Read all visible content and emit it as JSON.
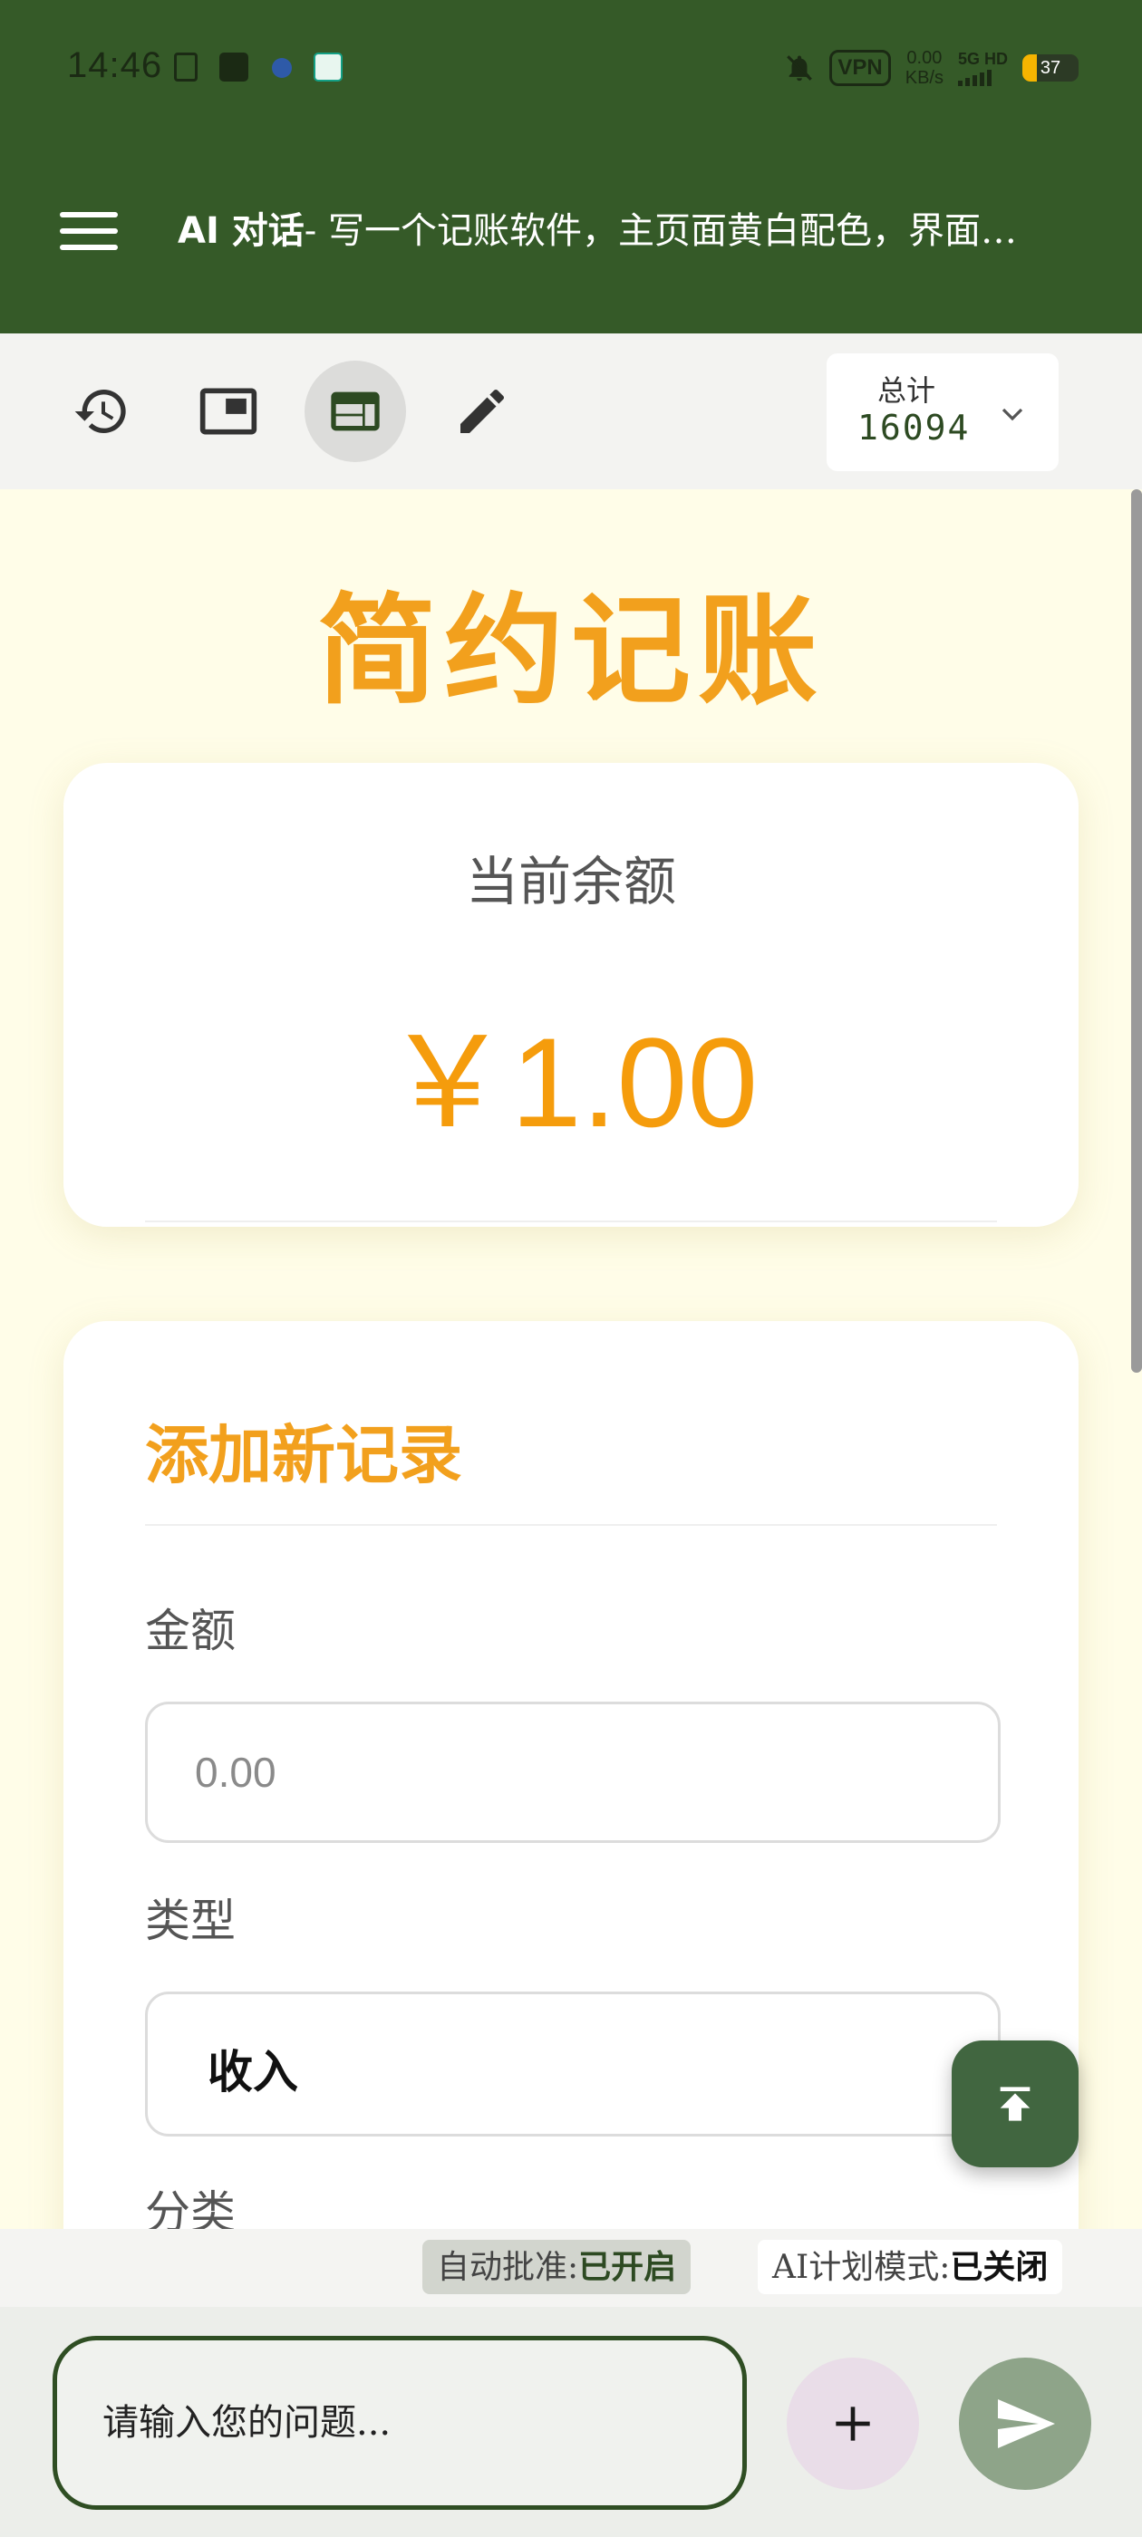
{
  "status_bar": {
    "time": "14:46",
    "vpn": "VPN",
    "net_speed_value": "0.00",
    "net_speed_unit": "KB/s",
    "network_type": "5G HD",
    "battery": "37"
  },
  "app_bar": {
    "title_main": "AI 对话",
    "title_rest": "- 写一个记账软件，主页面黄白配色，界面…"
  },
  "toolbar": {
    "total_label": "总计",
    "total_value": "16094"
  },
  "page": {
    "title": "简约记账",
    "balance_label": "当前余额",
    "balance_value": "￥1.00",
    "form_title": "添加新记录",
    "amount_label": "金额",
    "amount_placeholder": "0.00",
    "type_label": "类型",
    "type_value": "收入",
    "category_label": "分类"
  },
  "chips": {
    "auto_approve_label": "自动批准:",
    "auto_approve_value": "已开启",
    "plan_mode_label": "AI计划模式:",
    "plan_mode_value": "已关闭"
  },
  "input": {
    "placeholder": "请输入您的问题..."
  },
  "colors": {
    "header_green": "#355a28",
    "accent_orange": "#f2a01d",
    "page_background": "#fffde8"
  }
}
